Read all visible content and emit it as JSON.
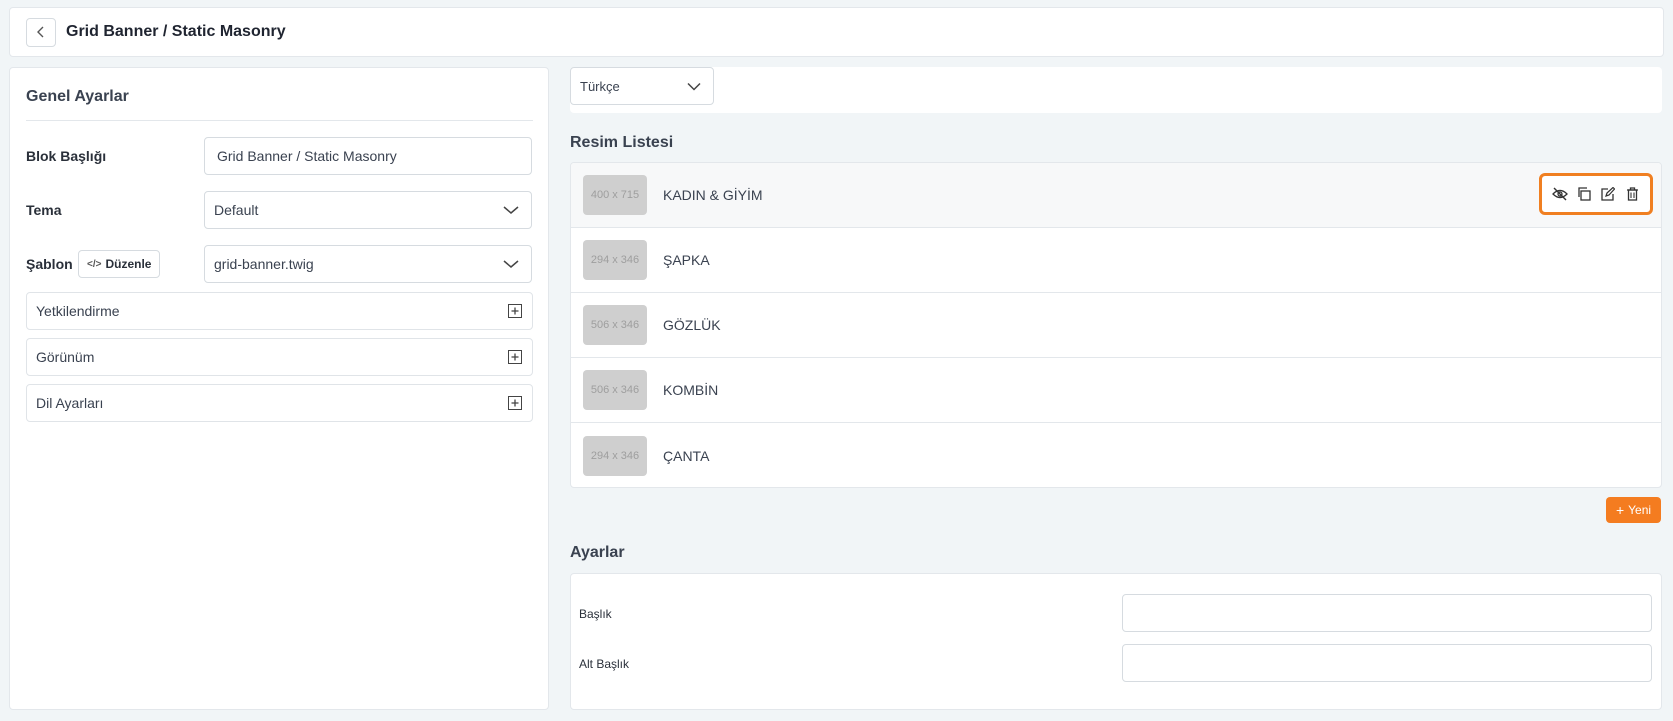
{
  "header": {
    "title": "Grid Banner / Static Masonry"
  },
  "general": {
    "title": "Genel Ayarlar",
    "block_title_label": "Blok Başlığı",
    "block_title_value": "Grid Banner / Static Masonry",
    "theme_label": "Tema",
    "theme_value": "Default",
    "template_label": "Şablon",
    "edit_label": "Düzenle",
    "template_value": "grid-banner.twig",
    "accordions": [
      "Yetkilendirme",
      "Görünüm",
      "Dil Ayarları"
    ]
  },
  "language": {
    "selected": "Türkçe"
  },
  "image_list": {
    "title": "Resim Listesi",
    "items": [
      {
        "size": "400 x 715",
        "name": "KADIN & GİYİM"
      },
      {
        "size": "294 x 346",
        "name": "ŞAPKA"
      },
      {
        "size": "506 x 346",
        "name": "GÖZLÜK"
      },
      {
        "size": "506 x 346",
        "name": "KOMBİN"
      },
      {
        "size": "294 x 346",
        "name": "ÇANTA"
      }
    ],
    "new_label": "Yeni",
    "action_icons": [
      "eye-off-icon",
      "copy-icon",
      "edit-icon",
      "trash-icon"
    ],
    "highlight_color": "#f07f21"
  },
  "settings": {
    "title": "Ayarlar",
    "fields": [
      {
        "label": "Başlık",
        "value": ""
      },
      {
        "label": "Alt Başlık",
        "value": ""
      }
    ]
  },
  "colors": {
    "accent": "#f47c20",
    "background": "#f1f5f7"
  }
}
